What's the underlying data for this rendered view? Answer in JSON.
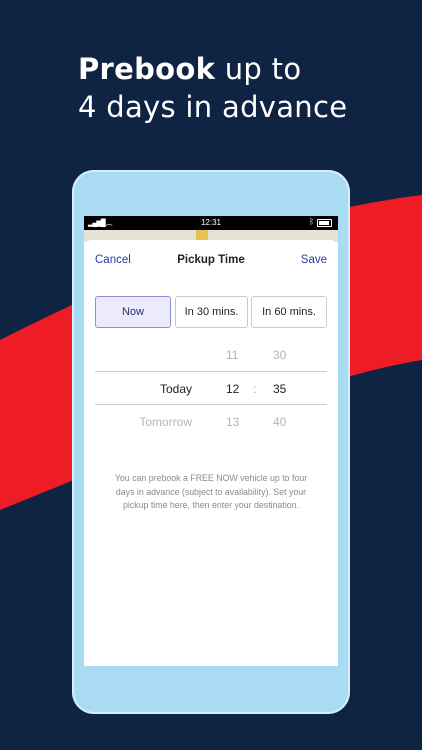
{
  "headline": {
    "bold": "Prebook",
    "line1_rest": " up to",
    "line2": "4 days in advance"
  },
  "status_bar": {
    "time": "12:31"
  },
  "nav": {
    "cancel": "Cancel",
    "title": "Pickup Time",
    "save": "Save"
  },
  "presets": [
    {
      "label": "Now",
      "selected": true
    },
    {
      "label": "In 30 mins.",
      "selected": false
    },
    {
      "label": "In 60 mins.",
      "selected": false
    }
  ],
  "picker": {
    "rows": [
      {
        "day": "",
        "hour": "11",
        "sep": "",
        "minute": "30",
        "selected": false
      },
      {
        "day": "Today",
        "hour": "12",
        "sep": ":",
        "minute": "35",
        "selected": true
      },
      {
        "day": "Tomorrow",
        "hour": "13",
        "sep": "",
        "minute": "40",
        "selected": false
      }
    ]
  },
  "info_text": "You can prebook a FREE NOW vehicle up to four days in advance (subject to availability). Set your pickup time here, then enter your destination.",
  "colors": {
    "background": "#0f2342",
    "accent_red": "#ee1c25",
    "phone_frame": "#a9dbf3",
    "link": "#2e3aa0"
  }
}
